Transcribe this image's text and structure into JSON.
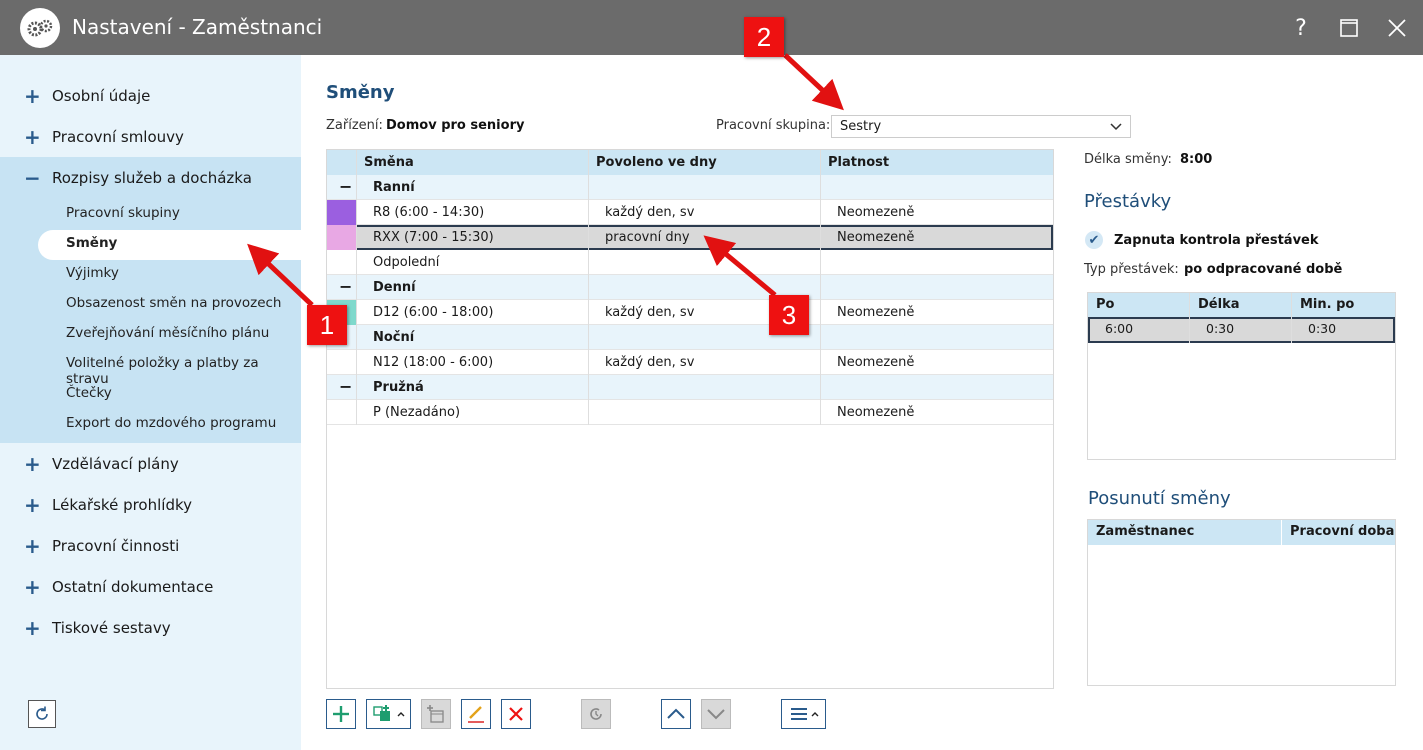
{
  "window": {
    "title": "Nastavení - Zaměstnanci",
    "help": "?",
    "maximize": "☐",
    "close": "✕"
  },
  "sidebar": {
    "groups_top": [
      {
        "sign": "+",
        "label": "Osobní údaje"
      },
      {
        "sign": "+",
        "label": "Pracovní smlouvy"
      },
      {
        "sign": "−",
        "label": "Rozpisy služeb a docházka"
      }
    ],
    "subitems": [
      "Pracovní skupiny",
      "Směny",
      "Výjimky",
      "Obsazenost směn na provozech",
      "Zveřejňování měsíčního plánu",
      "Volitelné položky a platby za stravu",
      "Čtečky",
      "Export do mzdového programu"
    ],
    "groups_bottom": [
      {
        "sign": "+",
        "label": "Vzdělávací plány"
      },
      {
        "sign": "+",
        "label": "Lékařské prohlídky"
      },
      {
        "sign": "+",
        "label": "Pracovní činnosti"
      },
      {
        "sign": "+",
        "label": "Ostatní dokumentace"
      },
      {
        "sign": "+",
        "label": "Tiskové sestavy"
      }
    ]
  },
  "main": {
    "title": "Směny",
    "facility_label": "Zařízení:",
    "facility_value": "Domov pro seniory",
    "workgroup_label": "Pracovní skupina:",
    "workgroup_value": "Sestry",
    "columns": [
      "Směna",
      "Povoleno ve dny",
      "Platnost"
    ],
    "rows": [
      {
        "group": true,
        "sign": "−",
        "name": "Ranní"
      },
      {
        "name": "R8 (6:00 - 14:30)",
        "days": "každý den, sv",
        "validity": "Neomezeně",
        "color": "#9b5fe0"
      },
      {
        "name": "RXX (7:00 - 15:30)",
        "days": "pracovní dny",
        "validity": "Neomezeně",
        "color": "#e8a8e4",
        "selected": true
      },
      {
        "name": "Odpolední",
        "days": "",
        "validity": ""
      },
      {
        "group": true,
        "sign": "−",
        "name": "Denní"
      },
      {
        "name": "D12 (6:00 - 18:00)",
        "days": "každý den, sv",
        "validity": "Neomezeně",
        "color": "#7fd9cc"
      },
      {
        "group": true,
        "sign": "",
        "name": "Noční"
      },
      {
        "name": "N12 (18:00 - 6:00)",
        "days": "každý den, sv",
        "validity": "Neomezeně"
      },
      {
        "group": true,
        "sign": "−",
        "name": "Pružná"
      },
      {
        "name": "P (Nezadáno)",
        "days": "",
        "validity": "Neomezeně"
      }
    ]
  },
  "right": {
    "shift_length_label": "Délka směny:",
    "shift_length_value": "8:00",
    "breaks_title": "Přestávky",
    "breaks_check_label": "Zapnuta kontrola přestávek",
    "break_type_label": "Typ přestávek:",
    "break_type_value": "po odpracované době",
    "breaks_columns": [
      "Po",
      "Délka",
      "Min. po"
    ],
    "breaks_row": [
      "6:00",
      "0:30",
      "0:30"
    ],
    "shift_move_title": "Posunutí směny",
    "shift_move_columns": [
      "Zaměstnanec",
      "Pracovní doba"
    ]
  },
  "annotations": [
    "1",
    "2",
    "3"
  ],
  "colors": {
    "titlebar": "#6b6b6b",
    "accent": "#2a5b8c",
    "arrow": "#e11111"
  }
}
